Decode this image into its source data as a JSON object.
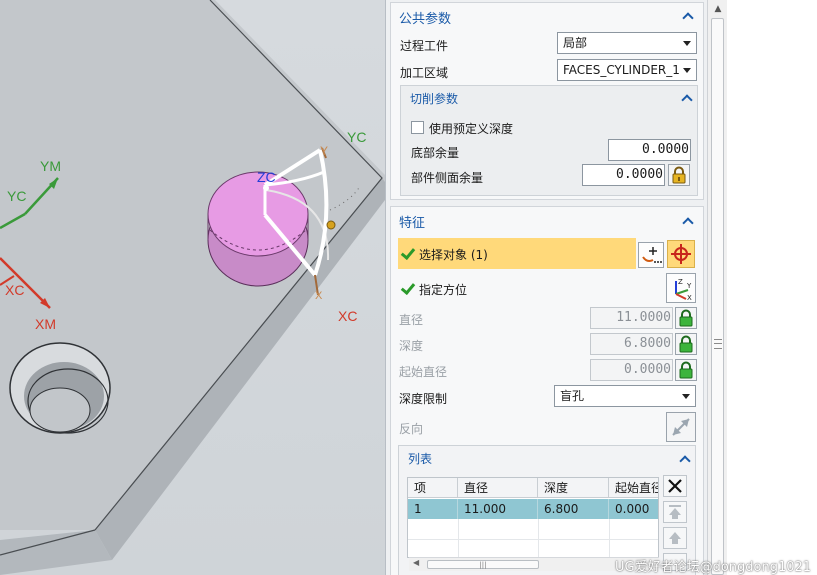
{
  "viewport": {
    "triad_labels": {
      "ym": "YM",
      "yc_left": "YC",
      "xc_left": "XC",
      "xm": "XM"
    },
    "csys_labels": {
      "zc": "ZC",
      "y": "Y",
      "yc": "YC",
      "xc": "XC",
      "x": "X"
    },
    "colors": {
      "green": "#3a9a3a",
      "red": "#d23a2a",
      "blue": "#2440d8",
      "hole_fill": "#e79be4"
    }
  },
  "common_params": {
    "title": "公共参数",
    "process_workpiece": {
      "label": "过程工件",
      "value": "局部"
    },
    "machining_area": {
      "label": "加工区域",
      "value": "FACES_CYLINDER_1"
    },
    "cut_params": {
      "title": "切削参数",
      "use_predefined_depth": {
        "label": "使用预定义深度",
        "checked": false
      },
      "floor_stock": {
        "label": "底部余量",
        "value": "0.0000"
      },
      "part_side_stock": {
        "label": "部件侧面余量",
        "value": "0.0000"
      }
    }
  },
  "feature": {
    "title": "特征",
    "select_object": {
      "label": "选择对象 (1)"
    },
    "specify_orientation": {
      "label": "指定方位"
    },
    "diameter": {
      "label": "直径",
      "value": "11.0000"
    },
    "depth": {
      "label": "深度",
      "value": "6.8000"
    },
    "start_diameter": {
      "label": "起始直径",
      "value": "0.0000"
    },
    "depth_limit": {
      "label": "深度限制",
      "value": "盲孔"
    },
    "reverse": {
      "label": "反向"
    },
    "list": {
      "title": "列表",
      "headers": [
        "项",
        "直径",
        "深度",
        "起始直径"
      ],
      "rows": [
        [
          "1",
          "11.000",
          "6.800",
          "0.000"
        ]
      ]
    }
  },
  "watermark": "UG爱好者论坛@dongdong1021",
  "accent_colors": {
    "group_title": "#1a5aa8",
    "selected_row": "#ffd97a",
    "table_selection": "#8fc6d2"
  }
}
